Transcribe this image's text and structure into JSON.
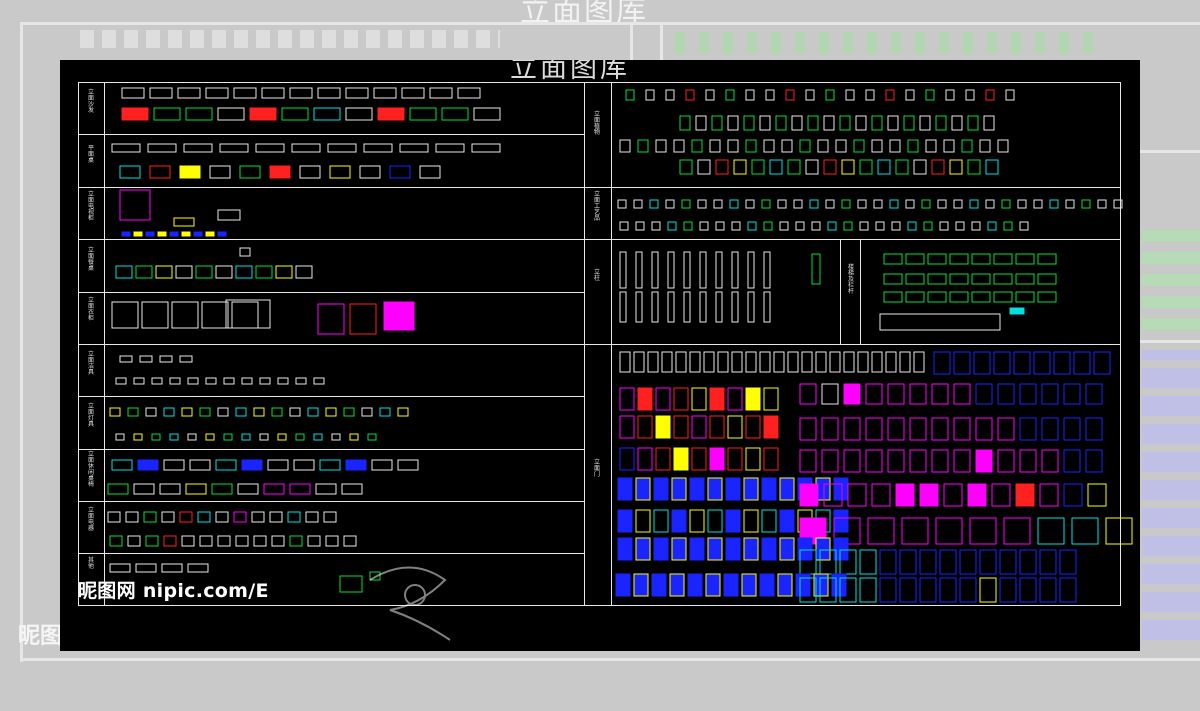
{
  "sheet": {
    "title": "立面图库",
    "watermark": "昵图网 nipic.com/E"
  },
  "ghost": {
    "title": "立面图库",
    "watermark": "昵图"
  },
  "colors": {
    "background": "#000000",
    "frame": "#ffffff",
    "red": "#ff2020",
    "yellow": "#ffff00",
    "green": "#00e040",
    "cyan": "#00e0e0",
    "blue": "#1a24ff",
    "magenta": "#ff00ff",
    "white": "#e8e8e8"
  },
  "rows_left": [
    {
      "id": "sofa",
      "label": "立面沙发"
    },
    {
      "id": "table",
      "label": "平面桌"
    },
    {
      "id": "appliance",
      "label": "立面电视柜"
    },
    {
      "id": "dining",
      "label": "立面餐桌"
    },
    {
      "id": "cabinet",
      "label": "立面衣柜"
    },
    {
      "id": "lamp",
      "label": "立面洁具"
    },
    {
      "id": "light",
      "label": "立面灯具"
    },
    {
      "id": "leisure",
      "label": "立面休闲桌椅"
    },
    {
      "id": "electric",
      "label": "立面电器"
    },
    {
      "id": "misc",
      "label": "其他"
    }
  ],
  "rows_right": [
    {
      "id": "plants",
      "label": "立面植物"
    },
    {
      "id": "decor",
      "label": "立面工艺品"
    },
    {
      "id": "column",
      "label": "立柱"
    },
    {
      "id": "stairs",
      "label": "楼梯及栏杆"
    },
    {
      "id": "door",
      "label": "立面门"
    }
  ]
}
